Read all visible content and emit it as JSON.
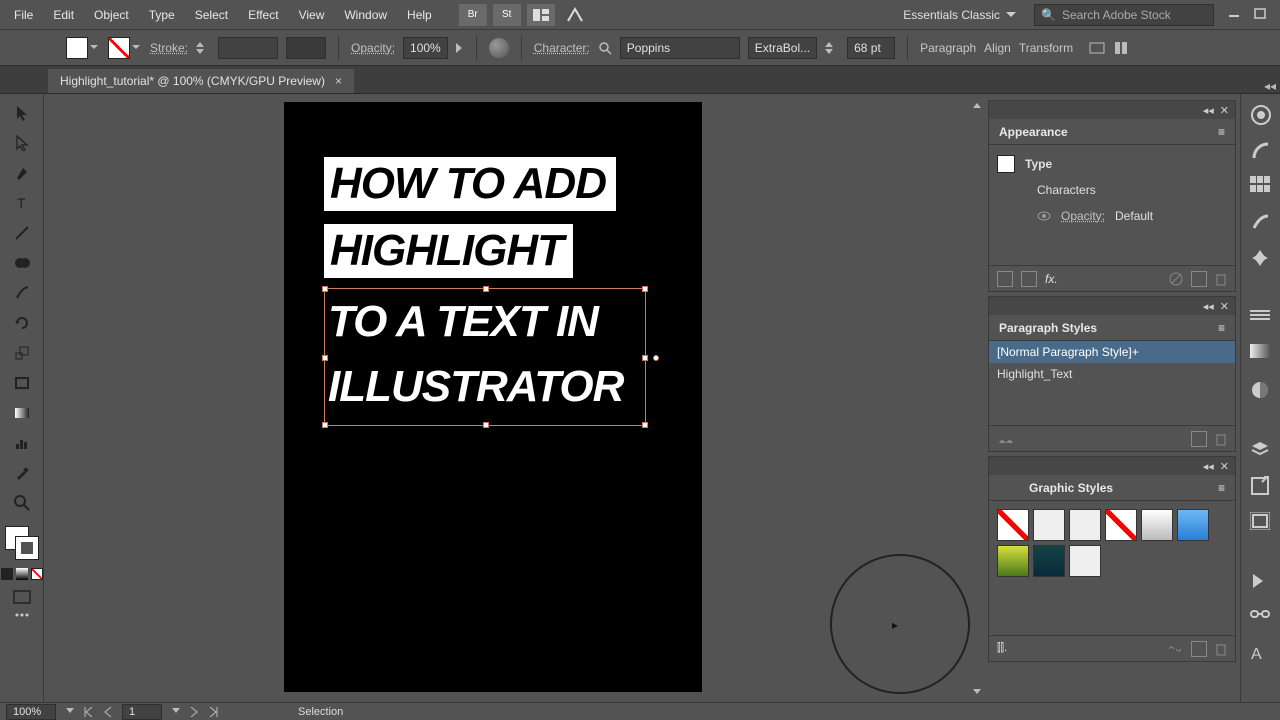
{
  "menu": {
    "file": "File",
    "edit": "Edit",
    "object": "Object",
    "type": "Type",
    "select": "Select",
    "effect": "Effect",
    "view": "View",
    "window": "Window",
    "help": "Help"
  },
  "header": {
    "br_label": "Br",
    "st_label": "St",
    "workspace": "Essentials Classic",
    "search_placeholder": "Search Adobe Stock"
  },
  "control": {
    "stroke_label": "Stroke:",
    "stroke_value": "",
    "opacity_label": "Opacity:",
    "opacity_value": "100%",
    "character_label": "Character:",
    "font_family": "Poppins",
    "font_style": "ExtraBol...",
    "font_size": "68 pt",
    "paragraph": "Paragraph",
    "align": "Align",
    "transform": "Transform"
  },
  "document": {
    "tab_title": "Highlight_tutorial* @ 100% (CMYK/GPU Preview)"
  },
  "artwork": {
    "line1": "HOW TO ADD",
    "line2": "HIGHLIGHT",
    "line3": "TO A TEXT IN",
    "line4": "ILLUSTRATOR"
  },
  "panels": {
    "appearance": {
      "title": "Appearance",
      "type_label": "Type",
      "characters": "Characters",
      "opacity_label": "Opacity:",
      "opacity_value": "Default"
    },
    "para_styles": {
      "title": "Paragraph Styles",
      "items": [
        "[Normal Paragraph Style]+",
        "Highlight_Text"
      ]
    },
    "graphic_styles": {
      "title": "Graphic Styles"
    }
  },
  "status": {
    "zoom": "100%",
    "artboard": "1",
    "tool": "Selection"
  },
  "icons": {
    "search": "🔍"
  }
}
